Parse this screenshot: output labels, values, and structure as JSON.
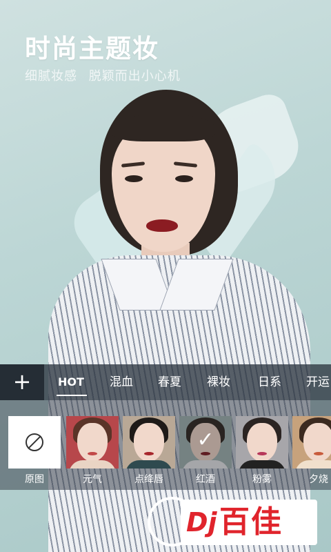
{
  "hero": {
    "title": "时尚主题妆",
    "subtitle": "细腻妆感  脱颖而出小心机"
  },
  "tabs": {
    "add_label": "+",
    "items": [
      {
        "label": "HOT",
        "active": true
      },
      {
        "label": "混血",
        "active": false
      },
      {
        "label": "春夏",
        "active": false
      },
      {
        "label": "裸妆",
        "active": false
      },
      {
        "label": "日系",
        "active": false
      },
      {
        "label": "开运",
        "active": false
      }
    ]
  },
  "styles": [
    {
      "label": "原图",
      "icon": "no-filter-icon",
      "selected": false
    },
    {
      "label": "元气",
      "selected": false
    },
    {
      "label": "点绛唇",
      "selected": false
    },
    {
      "label": "红酒",
      "selected": true,
      "check": "✓"
    },
    {
      "label": "粉雾",
      "selected": false
    },
    {
      "label": "夕烧",
      "selected": false
    }
  ],
  "watermark": {
    "logo": "Dj",
    "text": "百佳"
  },
  "colors": {
    "background": "#b9d3d1",
    "panel": "#2d3640",
    "lip": "#8b1c22",
    "brand_red": "#e0242c"
  }
}
